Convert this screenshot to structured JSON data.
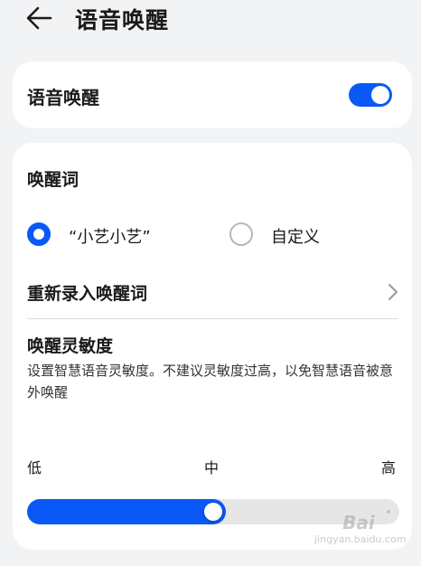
{
  "header": {
    "back_icon": "arrow-left-icon",
    "title": "语音唤醒"
  },
  "wake_card": {
    "label": "语音唤醒",
    "toggle_on": true
  },
  "settings_card": {
    "wake_word_title": "唤醒词",
    "options": [
      {
        "label": "“小艺小艺”",
        "selected": true
      },
      {
        "label": "自定义",
        "selected": false
      }
    ],
    "rerecord_label": "重新录入唤醒词",
    "rerecord_icon": "chevron-right-icon",
    "sensitivity_title": "唤醒灵敏度",
    "sensitivity_desc": "设置智慧语音灵敏度。不建议灵敏度过高，以免智慧语音被意外唤醒",
    "ticks": {
      "low": "低",
      "mid": "中",
      "high": "高"
    },
    "sensitivity_value": 0.5
  },
  "watermark": {
    "main": "Bai",
    "sub": "jingyan.baidu.com"
  },
  "colors": {
    "accent": "#0a59f7",
    "background": "#f1f3f5",
    "card": "#ffffff"
  }
}
